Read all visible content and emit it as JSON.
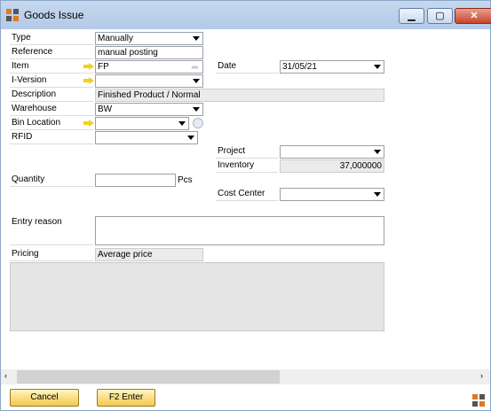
{
  "window": {
    "title": "Goods Issue"
  },
  "form": {
    "type": {
      "label": "Type",
      "value": "Manually"
    },
    "reference": {
      "label": "Reference",
      "value": "manual posting"
    },
    "item": {
      "label": "Item",
      "value": "FP"
    },
    "i_version": {
      "label": "I-Version",
      "value": ""
    },
    "description": {
      "label": "Description",
      "value": "Finished Product / Normal"
    },
    "warehouse": {
      "label": "Warehouse",
      "value": "BW"
    },
    "bin_location": {
      "label": "Bin Location",
      "value": ""
    },
    "rfid": {
      "label": "RFID",
      "value": ""
    },
    "quantity": {
      "label": "Quantity",
      "value": "",
      "unit": "Pcs"
    },
    "entry_reason": {
      "label": "Entry reason",
      "value": ""
    },
    "pricing": {
      "label": "Pricing",
      "value": "Average price"
    },
    "date": {
      "label": "Date",
      "value": "31/05/21"
    },
    "project": {
      "label": "Project",
      "value": ""
    },
    "inventory": {
      "label": "Inventory",
      "value": "37,000000"
    },
    "cost_center": {
      "label": "Cost Center",
      "value": ""
    }
  },
  "buttons": {
    "cancel": "Cancel",
    "enter": "F2 Enter"
  },
  "icons": [
    "app-logo-icon",
    "minimize-icon",
    "maximize-icon",
    "close-icon",
    "arrow-link-icon",
    "dropdown-icon",
    "scroll-left-icon",
    "scroll-right-icon"
  ]
}
